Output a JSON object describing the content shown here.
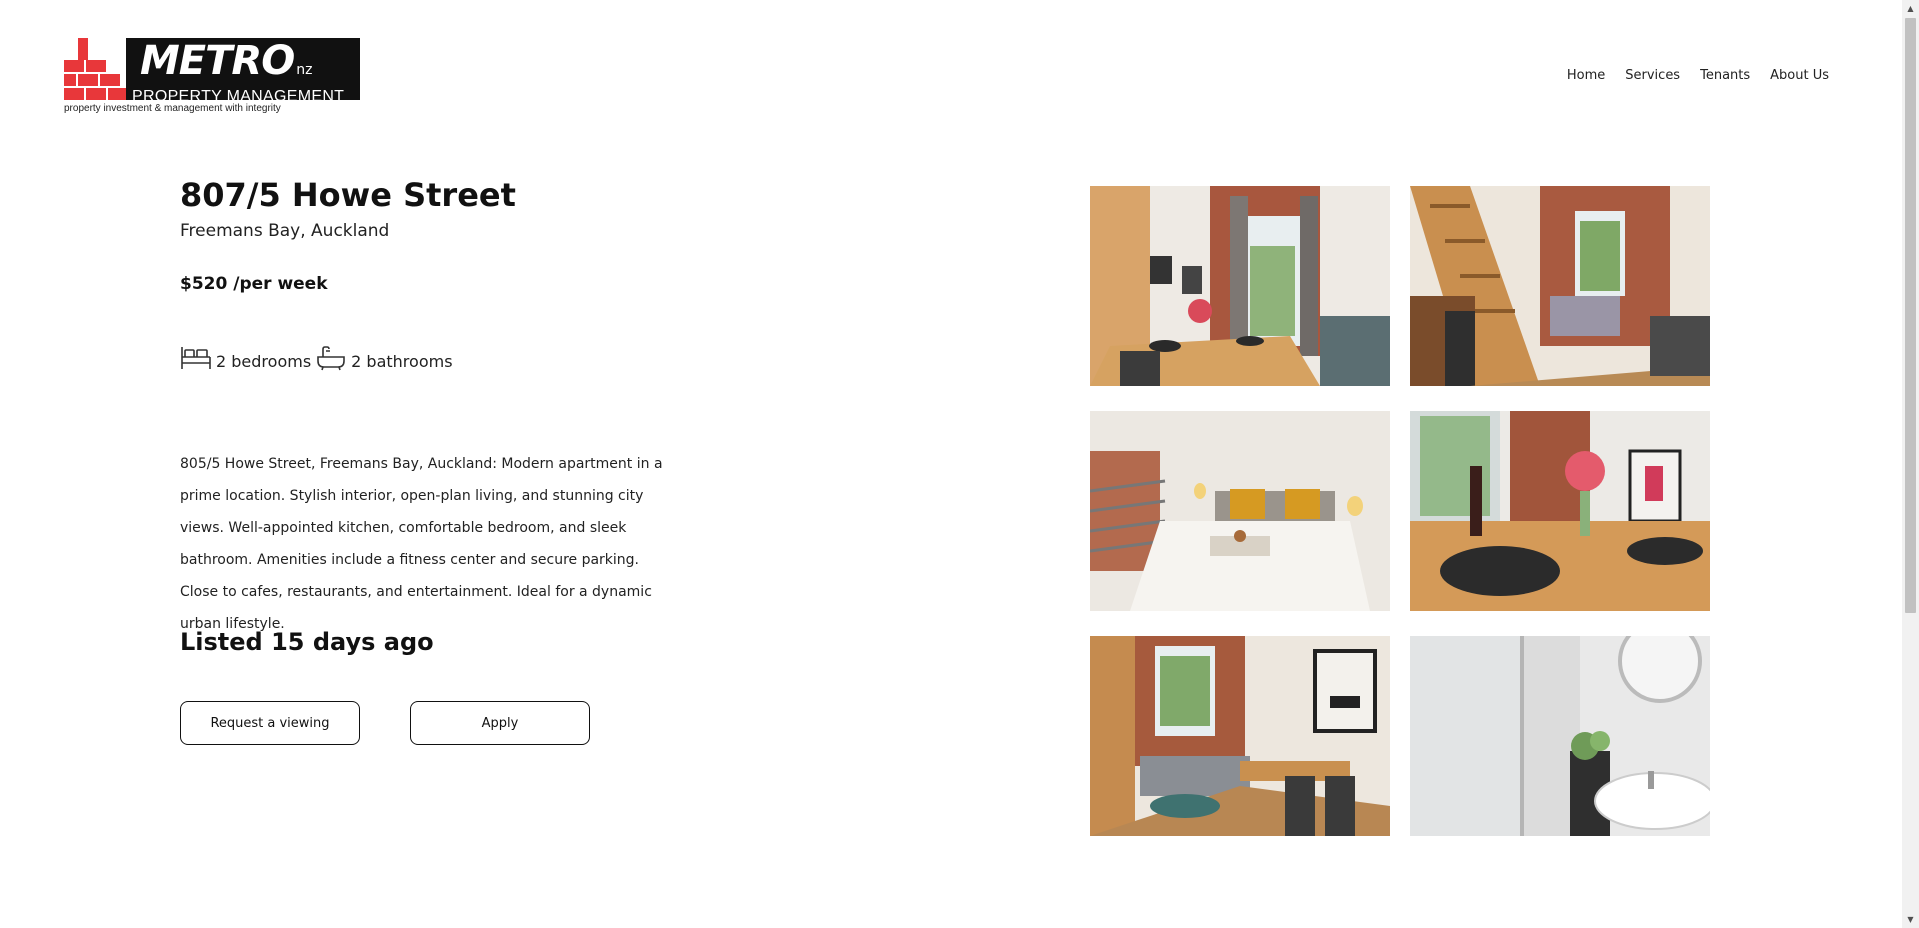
{
  "header": {
    "logo": {
      "word": "METRO",
      "suffix": "nz",
      "subtitle": "PROPERTY MANAGEMENT",
      "tagline": "property investment & management with integrity"
    },
    "nav": [
      "Home",
      "Services",
      "Tenants",
      "About Us"
    ]
  },
  "listing": {
    "address": "807/5 Howe Street",
    "suburb": "Freemans Bay, Auckland",
    "price": "$520 /per week",
    "bedrooms": "2 bedrooms",
    "bathrooms": "2 bathrooms",
    "description": "805/5 Howe Street, Freemans Bay, Auckland: Modern apartment in a prime location. Stylish interior, open-plan living, and stunning city views. Well-appointed kitchen, comfortable bedroom, and sleek bathroom. Amenities include a fitness center and secure parking. Close to cafes, restaurants, and entertainment. Ideal for a dynamic urban lifestyle.",
    "listed": "Listed 15 days ago"
  },
  "actions": {
    "request_viewing": "Request a viewing",
    "apply": "Apply"
  },
  "icons": {
    "bed": "bed-icon",
    "bath": "bathtub-icon"
  },
  "colors": {
    "brand_red": "#e8373a",
    "logo_black": "#111111",
    "button_border": "#111111"
  }
}
